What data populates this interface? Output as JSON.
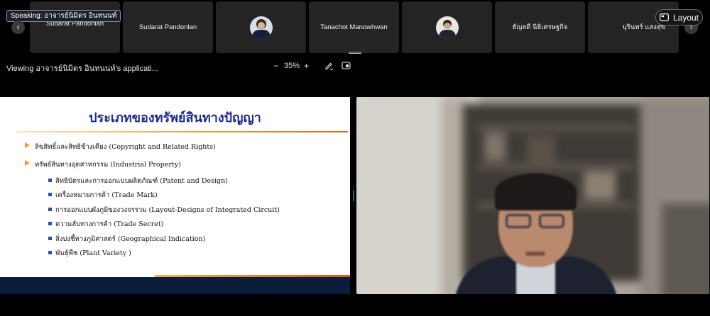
{
  "speaking_banner": "Speaking: อาจารย์นิมิตร อินทนนท์",
  "participants": [
    {
      "label": "Sudarat Pandonlan",
      "has_photo": false
    },
    {
      "label": "Sudarat Pandonlan",
      "has_photo": false
    },
    {
      "label": "",
      "has_photo": true
    },
    {
      "label": "Tanachot Manowhwan",
      "has_photo": false
    },
    {
      "label": "",
      "has_photo": true
    },
    {
      "label": "ธัญลดี นิธิเศรษฐกิจ",
      "has_photo": false
    },
    {
      "label": "บุรินทร์ แสงสุข",
      "has_photo": false
    }
  ],
  "layout_button": {
    "label": "Layout",
    "icon": "layout-icon"
  },
  "nav": {
    "prev": "‹",
    "next": "›"
  },
  "toolbar": {
    "viewing_text": "Viewing อาจารย์นิมิตร อินทนนท์'s applicati...",
    "zoom_out": "−",
    "zoom_level": "35%",
    "zoom_in": "+",
    "annotate_icon": "pen-icon",
    "popout_icon": "popout-icon"
  },
  "slide": {
    "title": "ประเภทของทรัพย์สินทางปัญญา",
    "items": [
      {
        "level": 1,
        "text": "ลิขสิทธิ์และสิทธิข้างเคียง (Copyright and Related Rights)"
      },
      {
        "level": 1,
        "text": "ทรัพย์สินทางอุตสาหกรรม (Industrial Property)"
      },
      {
        "level": 2,
        "text": "สิทธิบัตรและการออกแบบผลิตภัณฑ์ (Patent and Design)"
      },
      {
        "level": 2,
        "text": "เครื่องหมายการค้า (Trade Mark)"
      },
      {
        "level": 2,
        "text": "การออกแบบผังภูมิของวงจรรวม (Layout-Designs of Integrated Circuit)"
      },
      {
        "level": 2,
        "text": "ความลับทางการค้า (Trade Secret)"
      },
      {
        "level": 2,
        "text": "สิ่งบ่งชี้ทางภูมิศาสตร์ (Geographical Indication)"
      },
      {
        "level": 2,
        "text": "พันธุ์พืช (Plant Variety )"
      }
    ]
  },
  "colors": {
    "tile_bg": "#242424",
    "speaking_border": "#6b9bd6",
    "slide_title": "#1f2b8f",
    "slide_accent": "#f29a2e",
    "slide_bullet": "#2c4f9e",
    "slide_footer": "#0b1d3a"
  }
}
